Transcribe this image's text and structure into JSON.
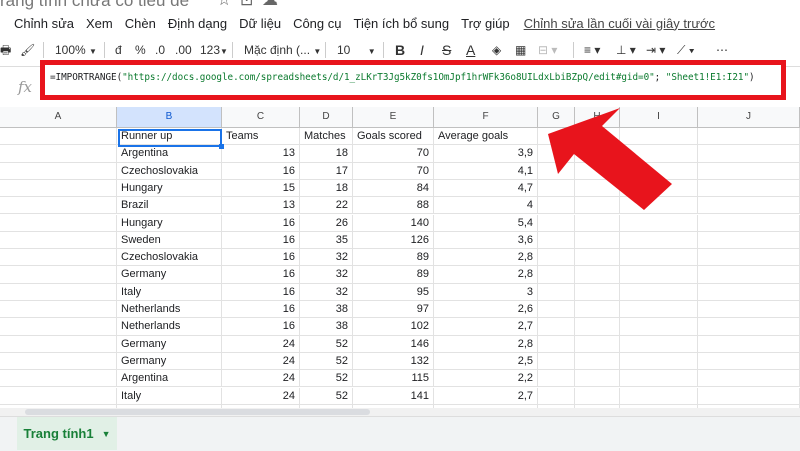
{
  "title": {
    "text": "rang tính chưa có tiêu đề"
  },
  "menu": {
    "items": [
      "Chỉnh sửa",
      "Xem",
      "Chèn",
      "Định dạng",
      "Dữ liệu",
      "Công cụ",
      "Tiện ích bổ sung",
      "Trợ giúp"
    ],
    "last_edit": "Chỉnh sửa lần cuối vài giây trước"
  },
  "toolbar": {
    "zoom": "100%",
    "currency": "đ",
    "percent": "%",
    "decrease_decimal": ".0",
    "increase_decimal": ".00",
    "more_formats": "123",
    "font": "Mặc định (...",
    "font_size": "10",
    "bold": "B",
    "italic": "I"
  },
  "formula_bar": {
    "fx": "fx",
    "prefix": "=IMPORTRANGE(",
    "url": "\"https://docs.google.com/spreadsheets/d/1_zLKrT3Jg5kZ0fs1OmJpf1hrWFk36o8UILdxLbiBZpQ/edit#gid=0\"",
    "separator": "; ",
    "range": "\"Sheet1!E1:I21\"",
    "suffix": ")"
  },
  "columns": [
    "A",
    "B",
    "C",
    "D",
    "E",
    "F",
    "G",
    "H",
    "I",
    "J"
  ],
  "table": {
    "headers": [
      "Runner up",
      "Teams",
      "Matches",
      "Goals scored",
      "Average goals"
    ],
    "rows": [
      [
        "Argentina",
        "13",
        "18",
        "70",
        "3,9"
      ],
      [
        "Czechoslovakia",
        "16",
        "17",
        "70",
        "4,1"
      ],
      [
        "Hungary",
        "15",
        "18",
        "84",
        "4,7"
      ],
      [
        "Brazil",
        "13",
        "22",
        "88",
        "4"
      ],
      [
        "Hungary",
        "16",
        "26",
        "140",
        "5,4"
      ],
      [
        "Sweden",
        "16",
        "35",
        "126",
        "3,6"
      ],
      [
        "Czechoslovakia",
        "16",
        "32",
        "89",
        "2,8"
      ],
      [
        "Germany",
        "16",
        "32",
        "89",
        "2,8"
      ],
      [
        "Italy",
        "16",
        "32",
        "95",
        "3"
      ],
      [
        "Netherlands",
        "16",
        "38",
        "97",
        "2,6"
      ],
      [
        "Netherlands",
        "16",
        "38",
        "102",
        "2,7"
      ],
      [
        "Germany",
        "24",
        "52",
        "146",
        "2,8"
      ],
      [
        "Germany",
        "24",
        "52",
        "132",
        "2,5"
      ],
      [
        "Argentina",
        "24",
        "52",
        "115",
        "2,2"
      ],
      [
        "Italy",
        "24",
        "52",
        "141",
        "2,7"
      ]
    ]
  },
  "sheet_tab": {
    "label": "Trang tính1"
  },
  "colors": {
    "highlight": "#e8141c",
    "selection": "#1a73e8",
    "tab_text": "#188038"
  }
}
